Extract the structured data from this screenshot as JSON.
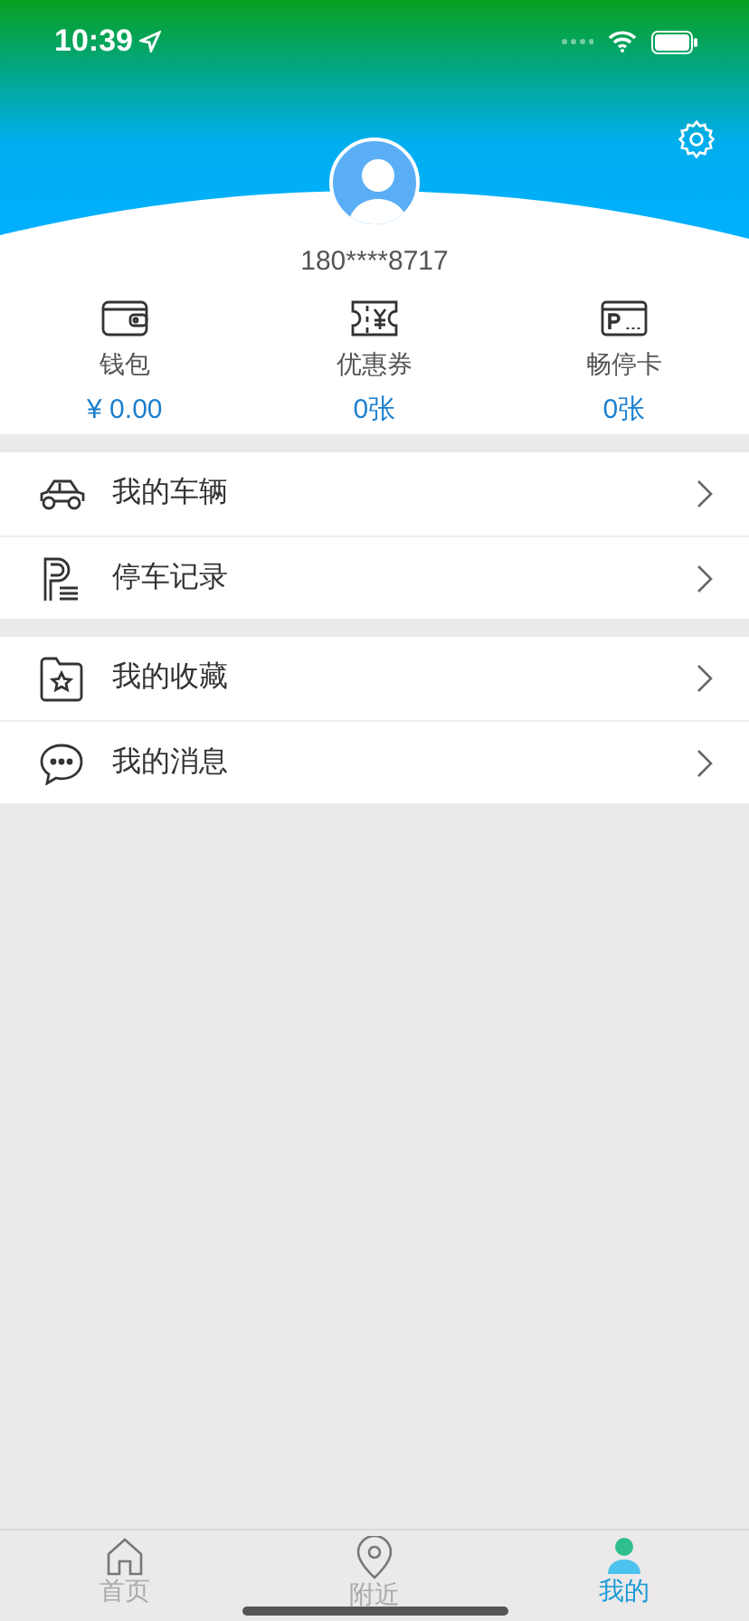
{
  "status_bar": {
    "time": "10:39"
  },
  "profile": {
    "phone": "180****8717"
  },
  "stats": [
    {
      "kind": "wallet",
      "label": "钱包",
      "value": "¥ 0.00"
    },
    {
      "kind": "coupon",
      "label": "优惠券",
      "value": "0张"
    },
    {
      "kind": "card",
      "label": "畅停卡",
      "value": "0张"
    }
  ],
  "menu_groups": [
    [
      {
        "kind": "car",
        "label": "我的车辆"
      },
      {
        "kind": "parking",
        "label": "停车记录"
      }
    ],
    [
      {
        "kind": "favorite",
        "label": "我的收藏"
      },
      {
        "kind": "message",
        "label": "我的消息"
      }
    ]
  ],
  "tab_bar": [
    {
      "kind": "home",
      "label": "首页",
      "selected": false
    },
    {
      "kind": "nearby",
      "label": "附近",
      "selected": false
    },
    {
      "kind": "me",
      "label": "我的",
      "selected": true
    }
  ]
}
